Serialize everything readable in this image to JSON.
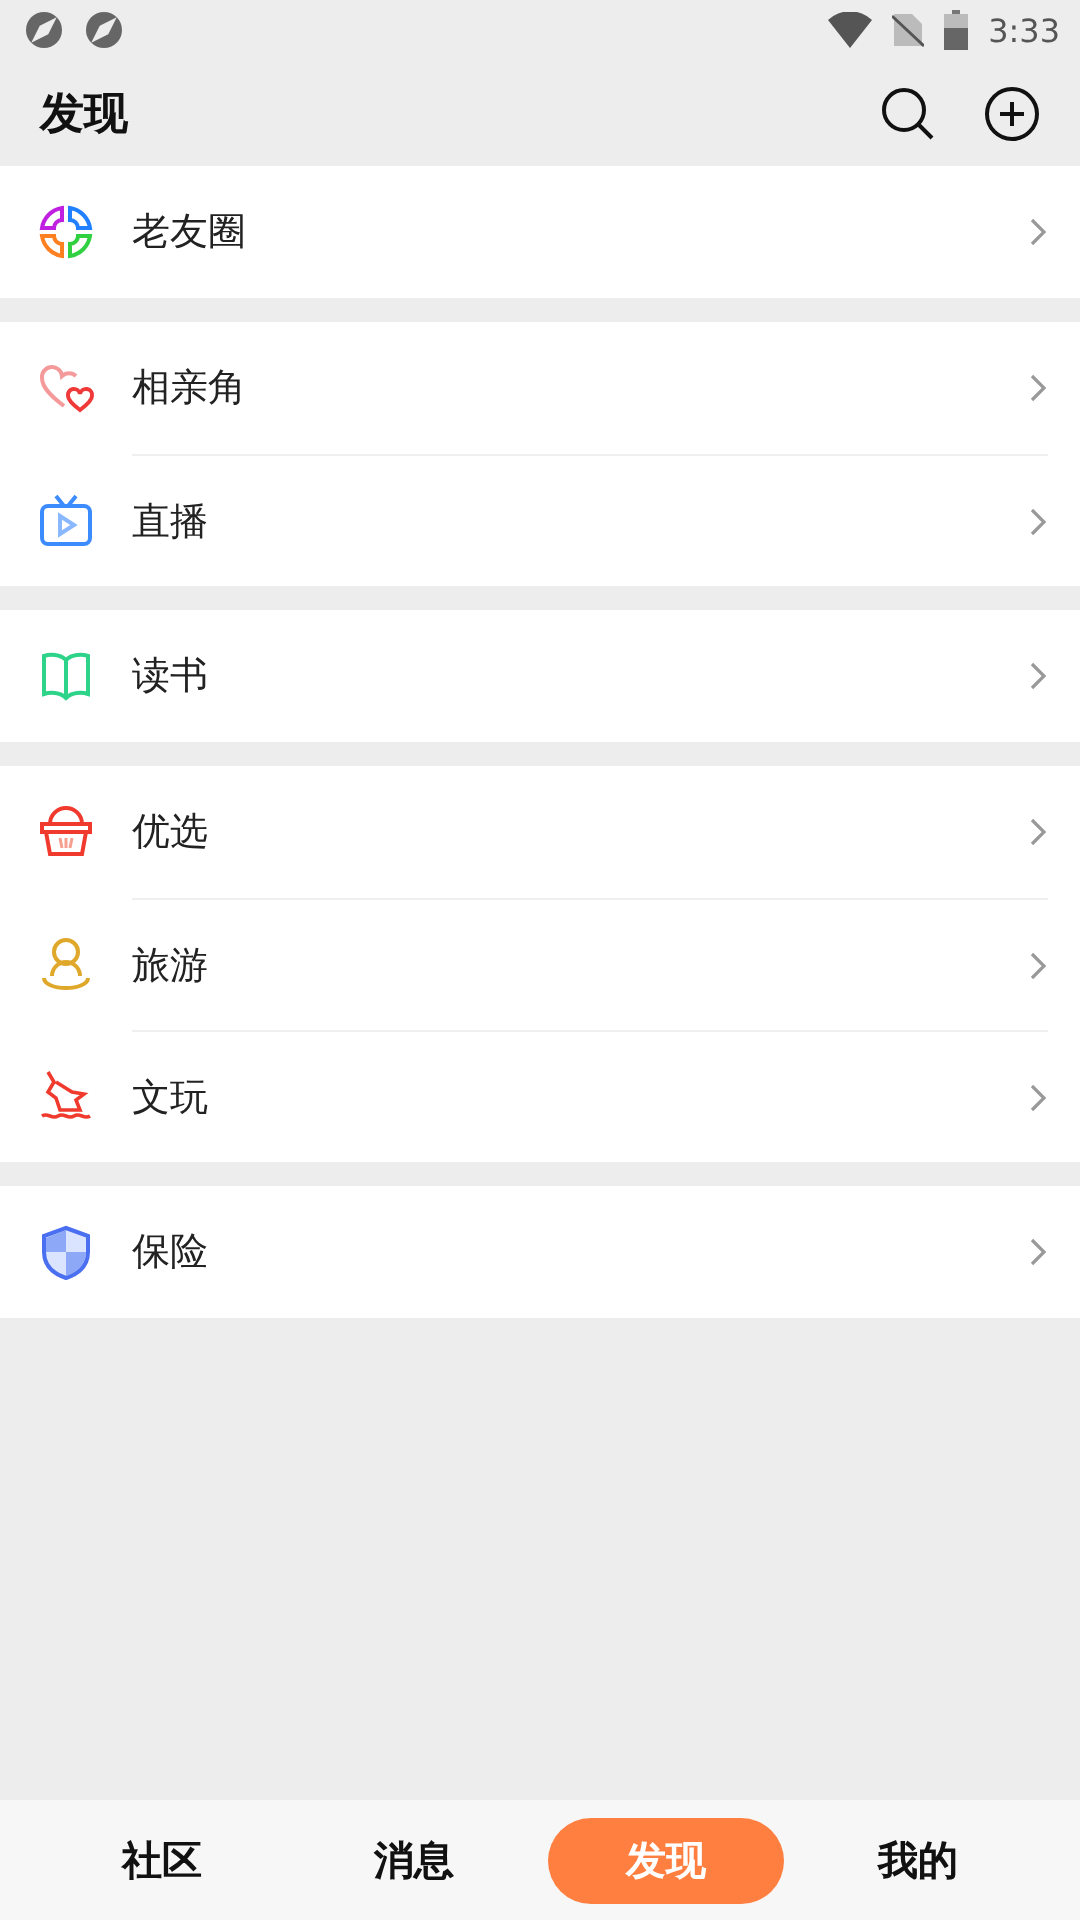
{
  "status_bar": {
    "time": "3:33"
  },
  "header": {
    "title": "发现"
  },
  "groups": [
    {
      "items": [
        {
          "label": "老友圈"
        }
      ]
    },
    {
      "items": [
        {
          "label": "相亲角"
        },
        {
          "label": "直播"
        }
      ]
    },
    {
      "items": [
        {
          "label": "读书"
        }
      ]
    },
    {
      "items": [
        {
          "label": "优选"
        },
        {
          "label": "旅游"
        },
        {
          "label": "文玩"
        }
      ]
    },
    {
      "items": [
        {
          "label": "保险"
        }
      ]
    }
  ],
  "tabs": [
    {
      "label": "社区",
      "selected": false
    },
    {
      "label": "消息",
      "selected": false
    },
    {
      "label": "发现",
      "selected": true
    },
    {
      "label": "我的",
      "selected": false
    }
  ]
}
